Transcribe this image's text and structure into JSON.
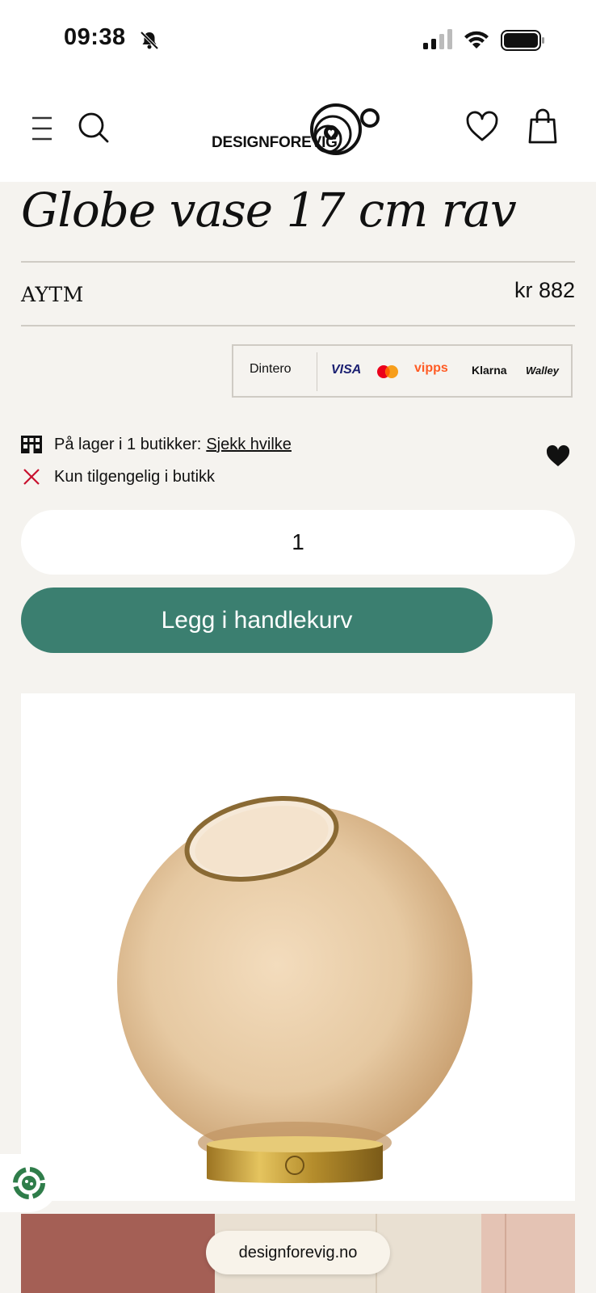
{
  "status_bar": {
    "time": "09:38",
    "icons": [
      "bell-muted-icon",
      "signal-icon",
      "wifi-icon",
      "battery-icon"
    ]
  },
  "header": {
    "logo_text": "DESIGNFOREVIG",
    "icons": [
      "menu-icon",
      "search-icon",
      "heart-icon",
      "bag-icon"
    ]
  },
  "product": {
    "title": "Globe vase 17 cm rav",
    "brand": "AYTM",
    "price": "kr 882"
  },
  "payment": {
    "providers": [
      "Dintero",
      "VISA",
      "Mastercard",
      "vipps",
      "Klarna",
      "Walley"
    ]
  },
  "stock": {
    "in_stock_text": "På lager i 1 butikker:",
    "check_link": "Sjekk hvilke",
    "availability_text": "Kun tilgengelig i butikk"
  },
  "purchase": {
    "quantity": "1",
    "add_to_cart_label": "Legg i handlekurv"
  },
  "browser": {
    "url": "designforevig.no"
  },
  "colors": {
    "background": "#f5f3ef",
    "button": "#3b7f70",
    "error_x": "#c8102e",
    "vipps": "#ff5b24",
    "visa": "#1a1f71"
  }
}
